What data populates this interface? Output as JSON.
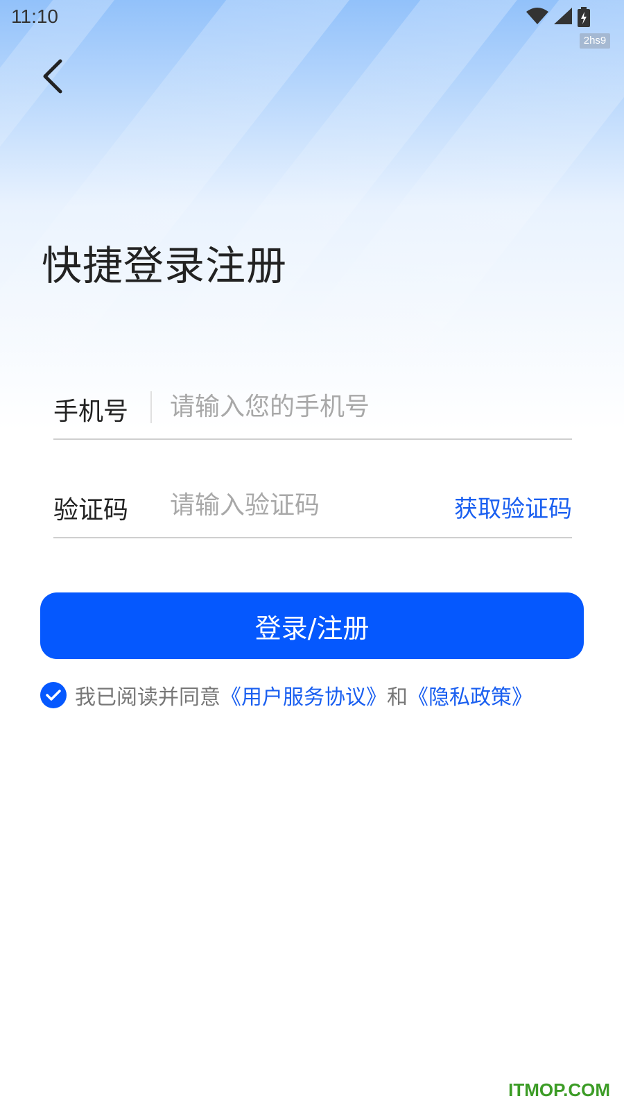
{
  "status_bar": {
    "time": "11:10",
    "badge": "2hs9"
  },
  "header": {
    "back_icon": "chevron-left-icon"
  },
  "page": {
    "title": "快捷登录注册"
  },
  "form": {
    "phone_label": "手机号",
    "phone_placeholder": "请输入您的手机号",
    "code_label": "验证码",
    "code_placeholder": "请输入验证码",
    "get_code_label": "获取验证码",
    "submit_label": "登录/注册"
  },
  "agreement": {
    "checked": true,
    "prefix": "我已阅读并同意",
    "terms_link": "《用户服务协议》",
    "conjunction": "和",
    "privacy_link": "《隐私政策》"
  },
  "watermark": "ITMOP.COM",
  "colors": {
    "primary": "#0558fe",
    "link": "#1a5ff0",
    "watermark": "#3c9c26"
  }
}
